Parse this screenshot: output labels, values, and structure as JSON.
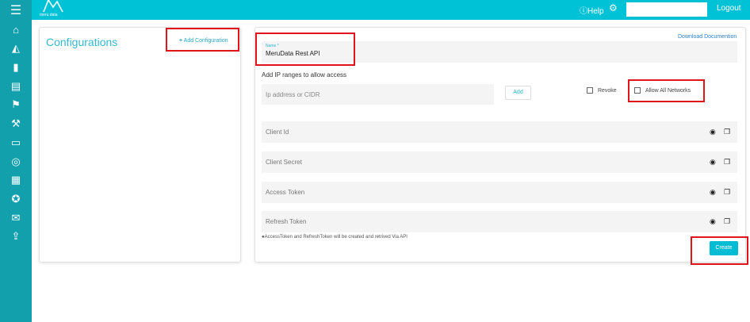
{
  "sidebar": {
    "items": [
      {
        "icon": "menu-icon",
        "glyph": "☰"
      },
      {
        "icon": "home-icon",
        "glyph": "⌂"
      },
      {
        "icon": "area-chart-icon",
        "glyph": "◭"
      },
      {
        "icon": "building-icon",
        "glyph": "▮"
      },
      {
        "icon": "document-icon",
        "glyph": "▤"
      },
      {
        "icon": "flag-icon",
        "glyph": "⚑"
      },
      {
        "icon": "gavel-icon",
        "glyph": "⚒"
      },
      {
        "icon": "inbox-icon",
        "glyph": "▭"
      },
      {
        "icon": "lifebuoy-icon",
        "glyph": "◎"
      },
      {
        "icon": "list-icon",
        "glyph": "▦"
      },
      {
        "icon": "support-icon",
        "glyph": "✪"
      },
      {
        "icon": "envelope-icon",
        "glyph": "✉"
      },
      {
        "icon": "upload-icon",
        "glyph": "⇪"
      }
    ]
  },
  "header": {
    "logo_text": "meru data",
    "help": "Help",
    "logout": "Logout",
    "search_value": ""
  },
  "configurations": {
    "title": "Configurations",
    "add_label": "Add Configuration"
  },
  "form": {
    "download": "Download Documention",
    "name_label": "Name *",
    "name_value": "MeruData Rest API",
    "ip_label": "Add IP ranges to allow access",
    "ip_placeholder": "Ip address or CIDR",
    "add_button": "Add",
    "revoke": "Revoke",
    "allow_all": "Allow All Networks",
    "fields": [
      {
        "label": "Client Id"
      },
      {
        "label": "Client Secret"
      },
      {
        "label": "Access Token"
      },
      {
        "label": "Refresh Token"
      }
    ],
    "note": "AccessToken and RefreshToken will be created and retrived Via API",
    "create": "Create"
  },
  "colors": {
    "sidebar": "#13a0ad",
    "topbar": "#00c2d6",
    "accent": "#00b5cc",
    "highlight": "#e0141a"
  }
}
